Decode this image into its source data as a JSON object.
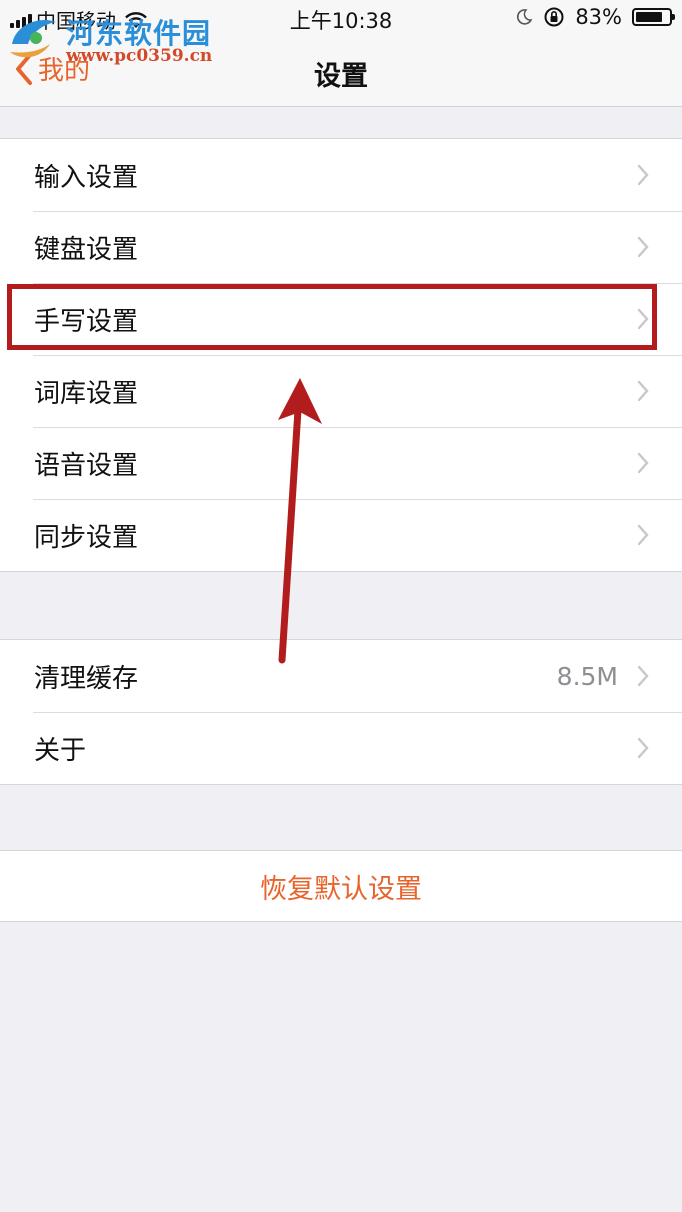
{
  "status_bar": {
    "carrier": "中国移动",
    "time": "上午10:38",
    "battery": "83%",
    "battery_level": 0.83
  },
  "watermark": {
    "title": "河东软件园",
    "url": "www.pc0359.cn"
  },
  "nav": {
    "back_label": "我的",
    "title": "设置"
  },
  "group1": {
    "items": [
      {
        "label": "输入设置"
      },
      {
        "label": "键盘设置"
      },
      {
        "label": "手写设置"
      },
      {
        "label": "词库设置"
      },
      {
        "label": "语音设置"
      },
      {
        "label": "同步设置"
      }
    ]
  },
  "group2": {
    "items": [
      {
        "label": "清理缓存",
        "value": "8.5M"
      },
      {
        "label": "关于"
      }
    ]
  },
  "reset": {
    "label": "恢复默认设置"
  },
  "colors": {
    "accent": "#e8642c",
    "annotation": "#b31c1c",
    "background": "#efeff4"
  }
}
